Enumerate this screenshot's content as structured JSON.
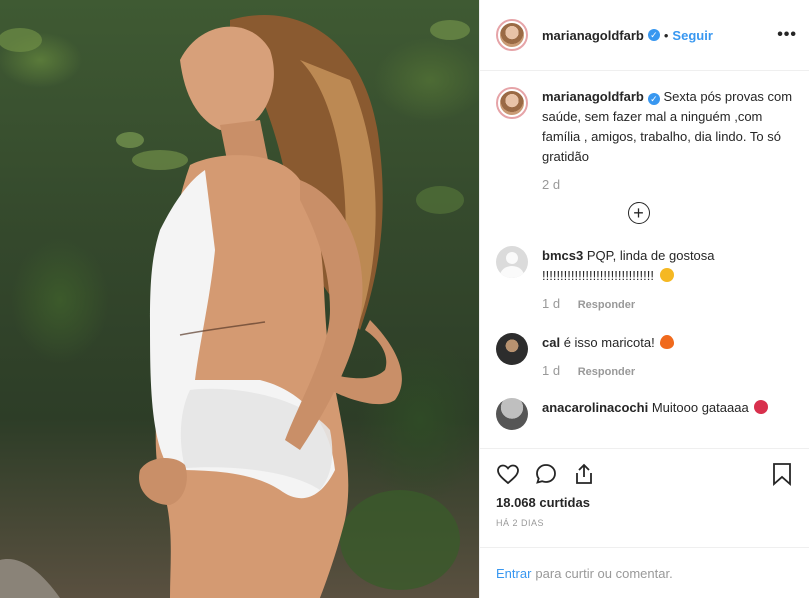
{
  "header": {
    "username": "marianagoldfarb",
    "separator": "•",
    "follow_label": "Seguir",
    "more_label": "•••"
  },
  "caption": {
    "username": "marianagoldfarb",
    "text": "Sexta pós provas com saúde, sem fazer mal a ninguém ,com família , amigos, trabalho, dia lindo. To só gratidão",
    "age": "2 d"
  },
  "comments": [
    {
      "username": "bmcs3",
      "text": "PQP, linda de gostosa !!!!!!!!!!!!!!!!!!!!!!!!!!!!!!!",
      "age": "1 d",
      "reply_label": "Responder",
      "emoji_color": "#f5b823"
    },
    {
      "username": "cal",
      "text": "é isso maricota!",
      "age": "1 d",
      "reply_label": "Responder",
      "emoji_color": "#f06a1d"
    },
    {
      "username": "anacarolinacochi",
      "text": "Muitooo gataaaa",
      "emoji_color": "#d8304d"
    }
  ],
  "actions": {
    "likes": "18.068 curtidas",
    "timestamp": "HÁ 2 DIAS"
  },
  "login": {
    "enter_label": "Entrar",
    "rest_label": "para curtir ou comentar."
  },
  "icons": [
    "heart-icon",
    "comment-icon",
    "share-icon",
    "bookmark-icon",
    "plus-circle-icon",
    "verified-icon",
    "more-options-icon"
  ],
  "colors": {
    "link": "#3897f0",
    "verified": "#3897f0",
    "muted": "#999999",
    "border": "#efefef"
  }
}
